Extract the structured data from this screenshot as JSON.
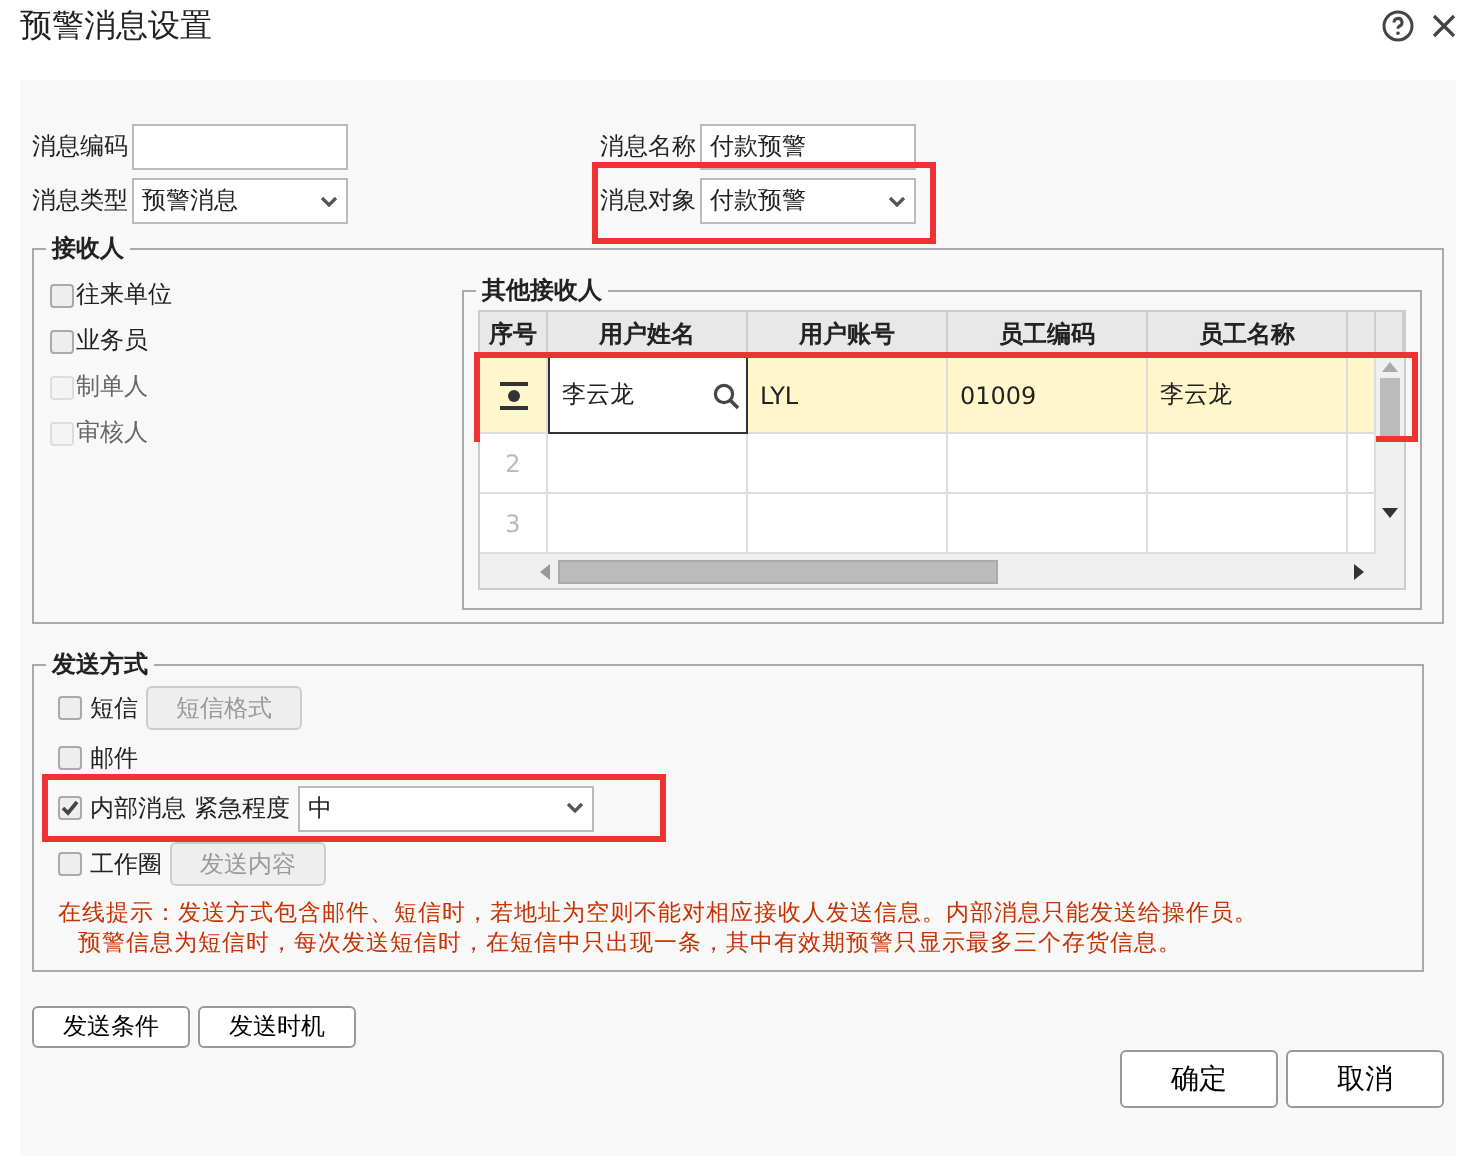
{
  "window": {
    "title": "预警消息设置"
  },
  "form": {
    "code": {
      "label": "消息编码"
    },
    "name": {
      "label": "消息名称",
      "value": "付款预警"
    },
    "type": {
      "label": "消息类型",
      "value": "预警消息"
    },
    "target": {
      "label": "消息对象",
      "value": "付款预警",
      "highlighted": true
    }
  },
  "receivers": {
    "title": "接收人",
    "options": [
      {
        "label": "往来单位",
        "checked": false,
        "disabled": false
      },
      {
        "label": "业务员",
        "checked": false,
        "disabled": false
      },
      {
        "label": "制单人",
        "checked": false,
        "disabled": true
      },
      {
        "label": "审核人",
        "checked": false,
        "disabled": true
      }
    ],
    "others": {
      "title": "其他接收人",
      "columns": [
        "序号",
        "用户姓名",
        "用户账号",
        "员工编码",
        "员工名称"
      ],
      "rows": [
        {
          "editing": true,
          "highlighted": true,
          "cells": [
            "李云龙",
            "LYL",
            "01009",
            "李云龙"
          ]
        },
        {
          "editing": false,
          "highlighted": false,
          "number": "2"
        },
        {
          "editing": false,
          "highlighted": false,
          "number": "3"
        }
      ]
    }
  },
  "send": {
    "title": "发送方式",
    "methods": [
      {
        "kind": "button",
        "label": "短信",
        "checked": false,
        "button": "短信格式",
        "button_disabled": true,
        "highlighted": false
      },
      {
        "kind": "plain",
        "label": "邮件",
        "checked": false,
        "highlighted": false
      },
      {
        "kind": "select",
        "label": "内部消息",
        "checked": true,
        "select_label": "紧急程度",
        "value": "中",
        "highlighted": true
      },
      {
        "kind": "button",
        "label": "工作圈",
        "checked": false,
        "button": "发送内容",
        "button_disabled": true,
        "highlighted": false
      }
    ],
    "notes": [
      "在线提示：发送方式包含邮件、短信时，若地址为空则不能对相应接收人发送信息。内部消息只能发送给操作员。",
      "预警信息为短信时，每次发送短信时，在短信中只出现一条，其中有效期预警只显示最多三个存货信息。"
    ]
  },
  "footer": {
    "left": [
      "发送条件",
      "发送时机"
    ],
    "right": [
      "确定",
      "取消"
    ]
  }
}
